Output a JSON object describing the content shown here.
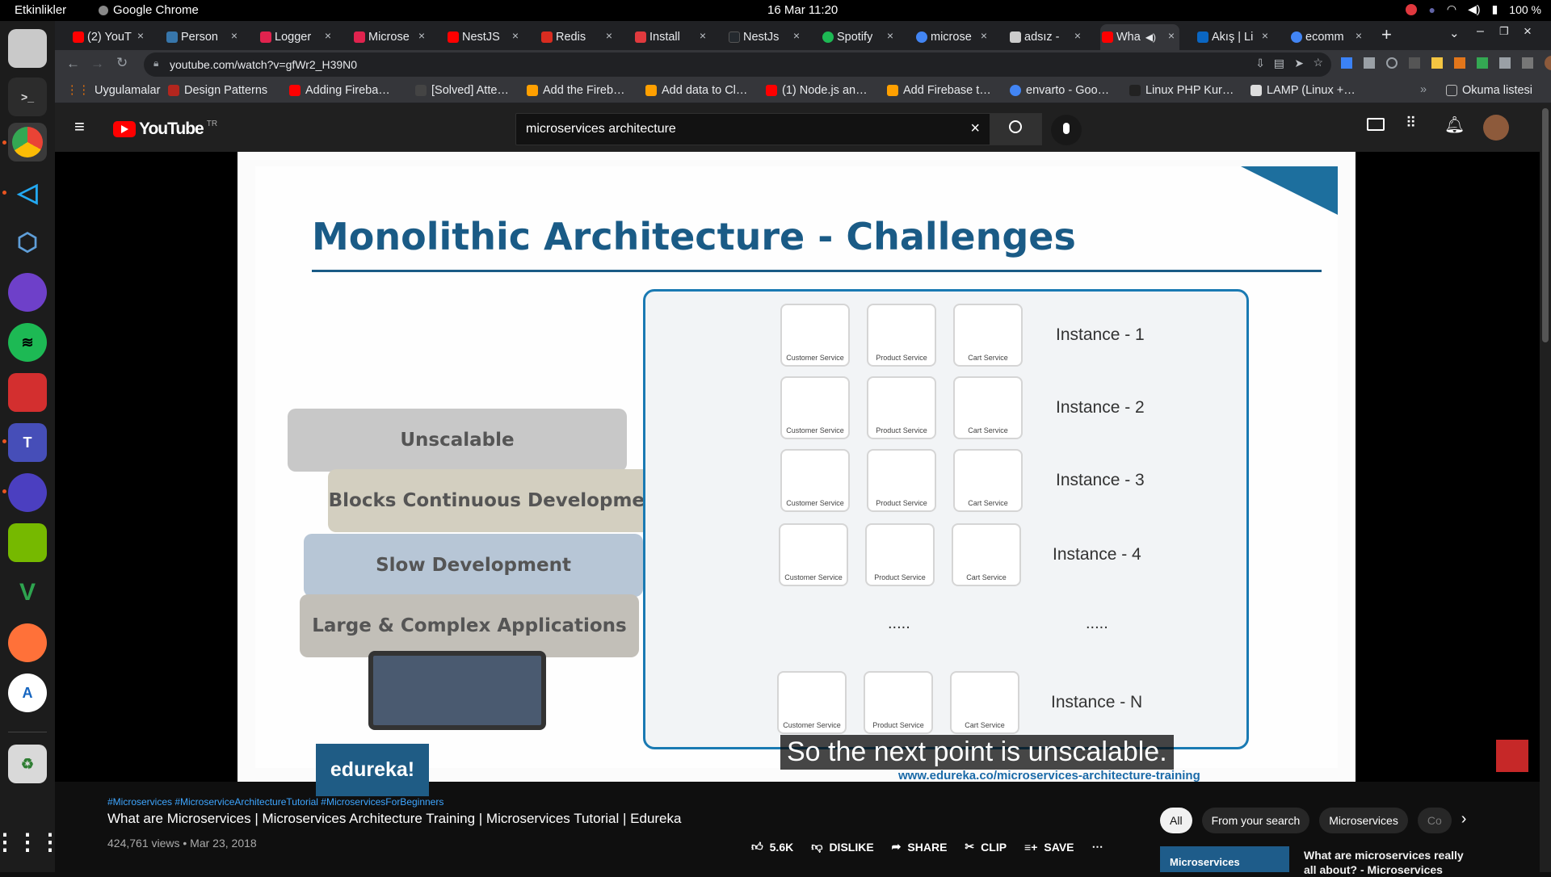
{
  "topbar": {
    "activities": "Etkinlikler",
    "app_name": "Google Chrome",
    "clock": "16 Mar  11:20",
    "battery": "100 %"
  },
  "tabs": [
    {
      "title": "(2) YouT",
      "color": "#ff0000"
    },
    {
      "title": "Person",
      "color": "#3776ab"
    },
    {
      "title": "Logger",
      "color": "#e0234e"
    },
    {
      "title": "Microse",
      "color": "#e0234e"
    },
    {
      "title": "NestJS",
      "color": "#ff0000"
    },
    {
      "title": "Redis",
      "color": "#d82c20"
    },
    {
      "title": "Install",
      "color": "#e03a3e"
    },
    {
      "title": "NestJs",
      "color": "#24292e"
    },
    {
      "title": "Spotify",
      "color": "#1db954"
    },
    {
      "title": "microse",
      "color": "#4285f4"
    },
    {
      "title": "adsız -",
      "color": "#cccccc"
    },
    {
      "title": "Wha",
      "color": "#ff0000"
    },
    {
      "title": "Akış | Li",
      "color": "#0a66c2"
    },
    {
      "title": "ecomm",
      "color": "#4285f4"
    }
  ],
  "address": {
    "url": "youtube.com/watch?v=gfWr2_H39N0"
  },
  "bookmarks": [
    {
      "label": "Uygulamalar",
      "color": "#e8710a"
    },
    {
      "label": "Design Patterns",
      "color": "#b3261e"
    },
    {
      "label": "Adding Fireba…",
      "color": "#ff0000"
    },
    {
      "label": "[Solved] Atte…",
      "color": "#444444"
    },
    {
      "label": "Add the Fireb…",
      "color": "#ffa000"
    },
    {
      "label": "Add data to Cl…",
      "color": "#ffa000"
    },
    {
      "label": "(1) Node.js an…",
      "color": "#ff0000"
    },
    {
      "label": "Add Firebase t…",
      "color": "#ffa000"
    },
    {
      "label": "envarto - Goo…",
      "color": "#4285f4"
    },
    {
      "label": "Linux PHP Kur…",
      "color": "#222222"
    },
    {
      "label": "LAMP (Linux +…",
      "color": "#dddddd"
    },
    {
      "label": "Okuma listesi",
      "color": "#bbbbbb"
    }
  ],
  "youtube": {
    "logo": "YouTube",
    "region": "TR",
    "search_value": "microservices architecture"
  },
  "slide": {
    "title": "Monolithic Architecture - Challenges",
    "rocks": [
      "Unscalable",
      "Blocks Continuous Development",
      "Slow Development",
      "Large & Complex Applications"
    ],
    "service_labels": [
      "Customer Service",
      "Product Service",
      "Cart Service"
    ],
    "instances": [
      "Instance - 1",
      "Instance - 2",
      "Instance - 3",
      "Instance - 4",
      "Instance - N"
    ],
    "dots": ".....",
    "brand": "edureka!",
    "url": "www.edureka.co/microservices-architecture-training",
    "caption": "So the next point is unscalable."
  },
  "video": {
    "hashtags": "#Microservices #MicroserviceArchitectureTutorial #MicroservicesForBeginners",
    "title": "What are Microservices | Microservices Architecture Training | Microservices Tutorial | Edureka",
    "views_date": "424,761 views • Mar 23, 2018",
    "likes": "5.6K",
    "dislike": "DISLIKE",
    "share": "SHARE",
    "clip": "CLIP",
    "save": "SAVE"
  },
  "chips": [
    "All",
    "From your search",
    "Microservices",
    "Co"
  ],
  "recommendation": {
    "title": "What are microservices really all about? - Microservices",
    "thumb_text": "Microservices"
  }
}
